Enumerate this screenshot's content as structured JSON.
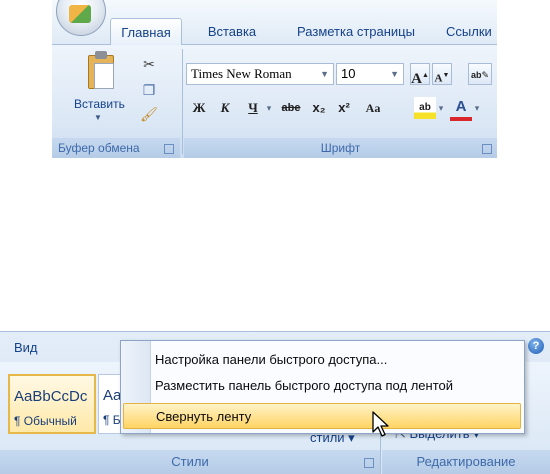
{
  "top_ribbon": {
    "tabs": [
      {
        "label": "Главная"
      },
      {
        "label": "Вставка"
      },
      {
        "label": "Разметка страницы"
      },
      {
        "label": "Ссылки"
      }
    ],
    "clipboard": {
      "paste_label": "Вставить",
      "group_label": "Буфер обмена"
    },
    "font": {
      "font_name": "Times New Roman",
      "font_size": "10",
      "grow_label": "A",
      "shrink_label": "A",
      "bold_label": "Ж",
      "italic_label": "К",
      "underline_label": "Ч",
      "strike_label": "abe",
      "subscript_label": "x₂",
      "superscript_label": "x²",
      "case_label": "Aa",
      "highlight_label": "ab",
      "font_color_label": "A",
      "group_label": "Шрифт"
    }
  },
  "bottom_ribbon": {
    "view_tab": "Вид",
    "help_label": "?",
    "style_tiles": [
      {
        "sample": "AaBbCcDc",
        "name": "¶ Обычный"
      },
      {
        "sample": "Aa",
        "name": "¶ Б"
      }
    ],
    "change_styles_label": "стили ▾",
    "select_label": "Выделить ▾",
    "styles_group_label": "Стили",
    "editing_group_label": "Редактирование"
  },
  "context_menu": {
    "items": [
      {
        "label": "Настройка панели быстрого доступа..."
      },
      {
        "label": "Разместить панель быстрого доступа под лентой"
      },
      {
        "label": "Свернуть ленту"
      }
    ]
  },
  "colors": {
    "tab_text": "#15428b",
    "highlight": "#ffd463",
    "font_color_bar": "#d8262b"
  }
}
